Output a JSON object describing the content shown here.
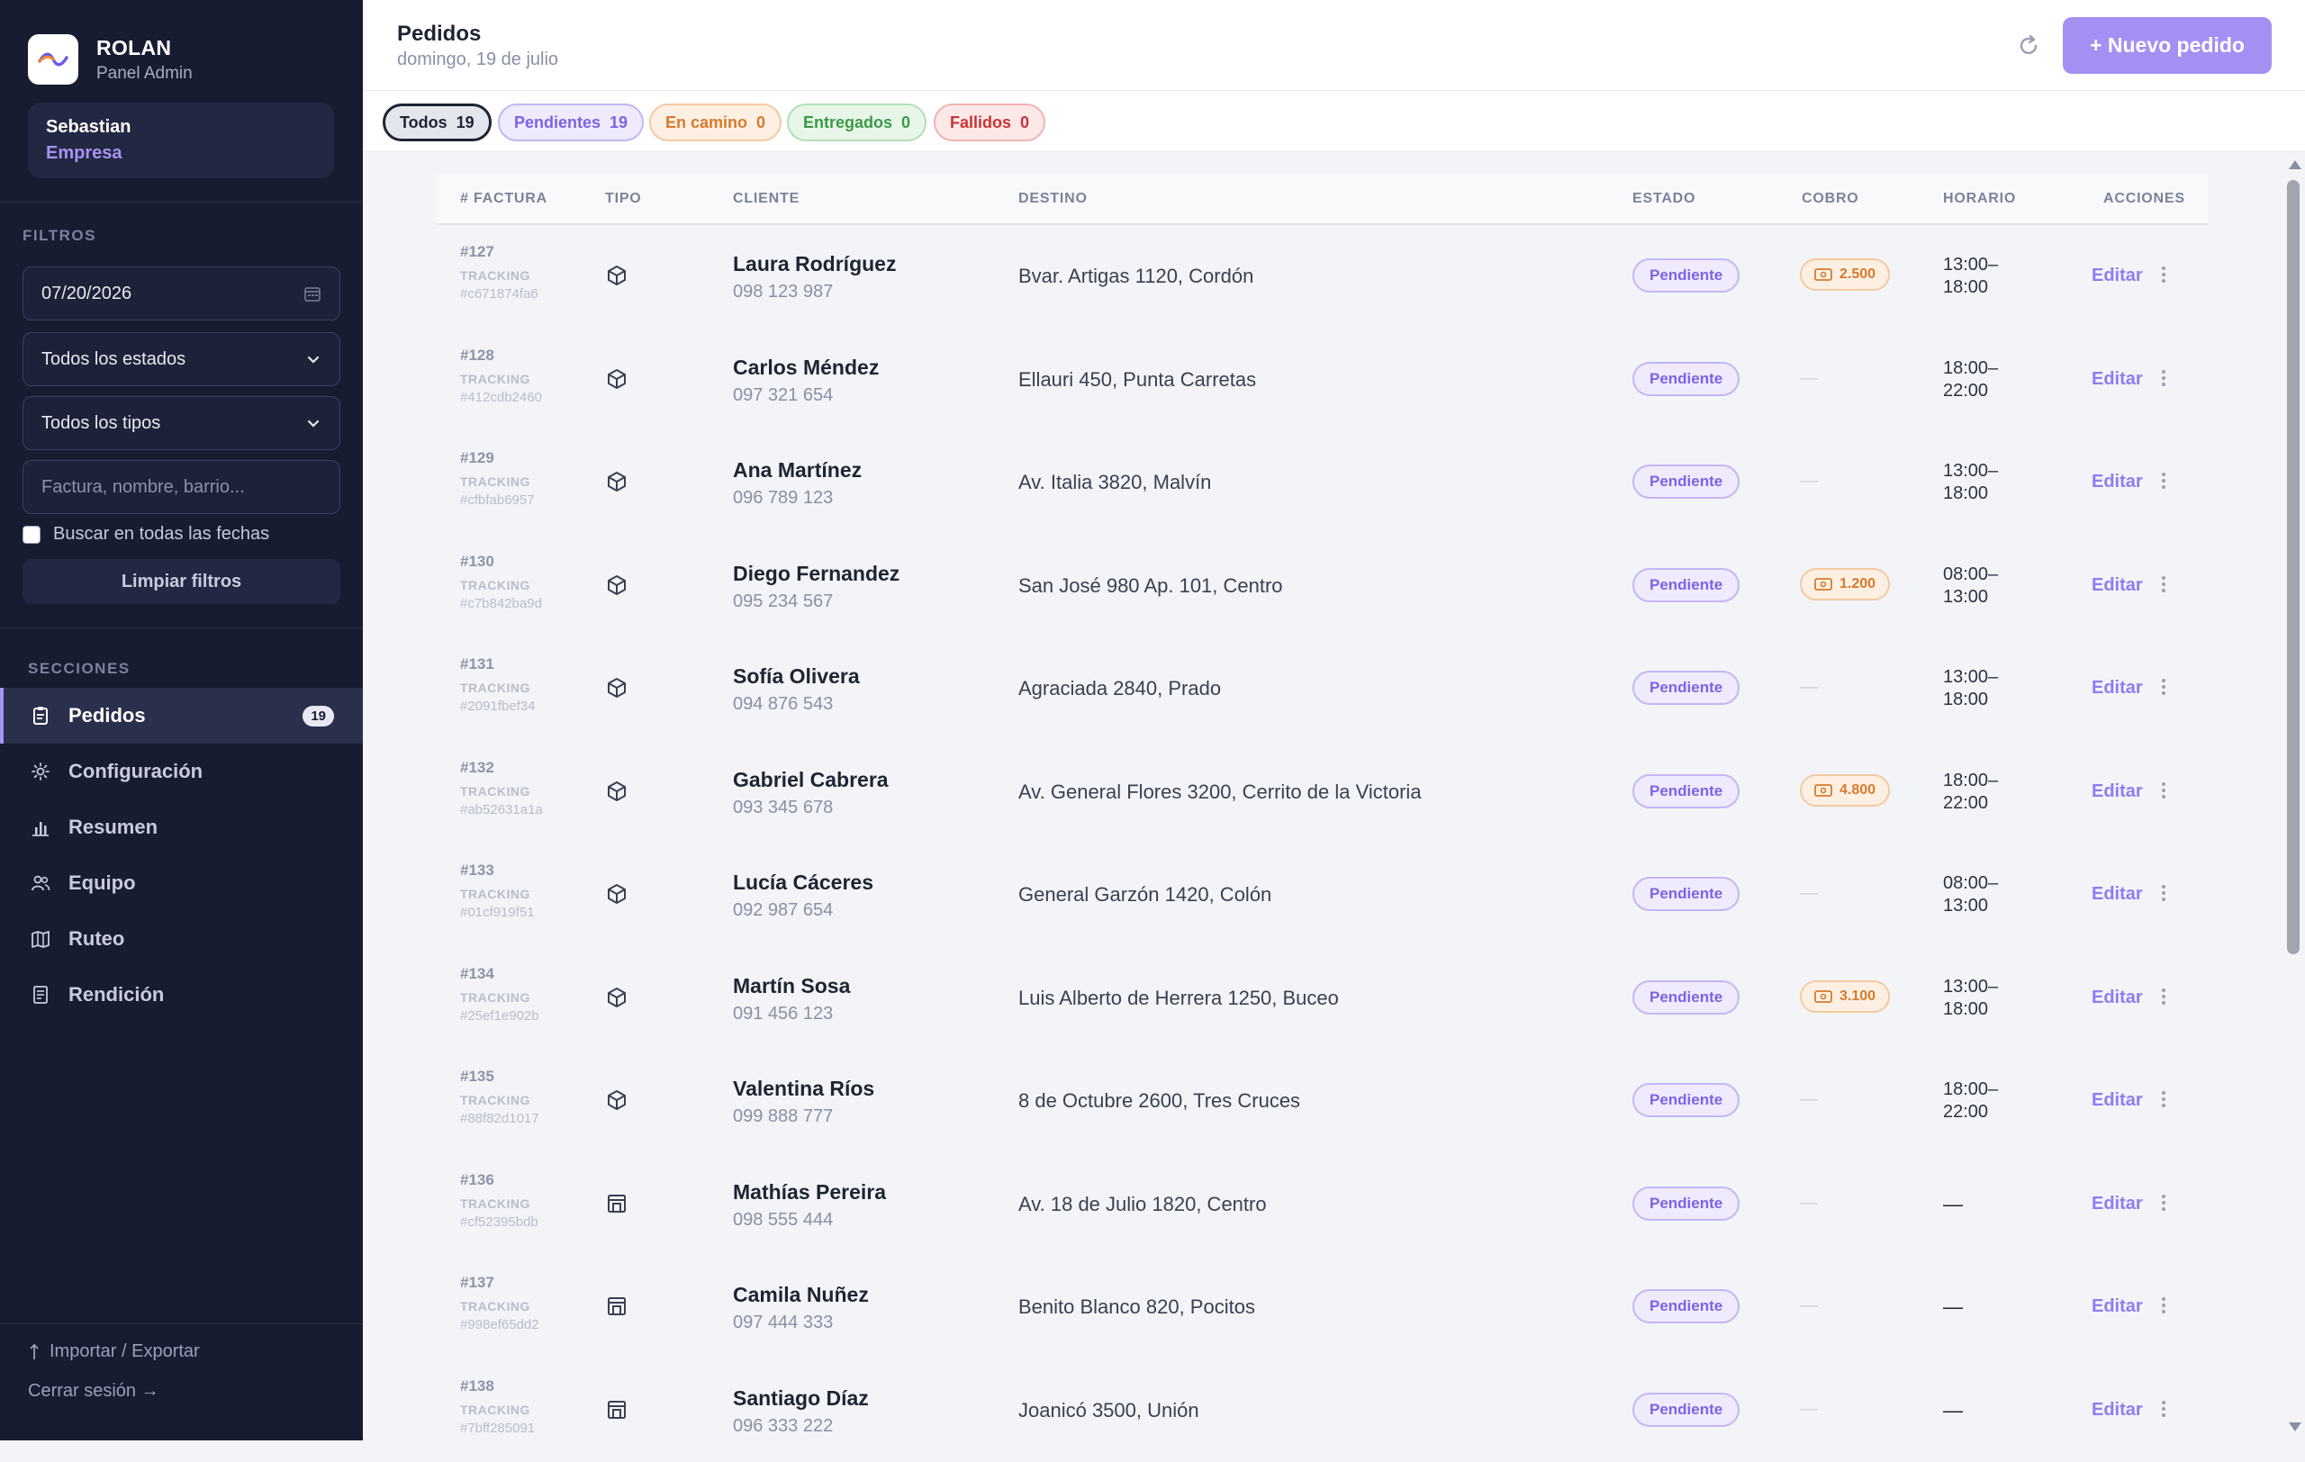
{
  "brand": {
    "name": "ROLAN",
    "subtitle": "Panel Admin"
  },
  "user": {
    "name": "Sebastian",
    "role": "Empresa"
  },
  "filters": {
    "section_label": "FILTROS",
    "date_value": "07/20/2026",
    "status_select": "Todos los estados",
    "type_select": "Todos los tipos",
    "search_placeholder": "Factura, nombre, barrio...",
    "search_all_dates": "Buscar en todas las fechas",
    "clear_label": "Limpiar filtros"
  },
  "sections": {
    "label": "SECCIONES",
    "items": [
      {
        "label": "Pedidos",
        "icon": "clipboard-icon",
        "badge": "19",
        "active": true
      },
      {
        "label": "Configuración",
        "icon": "gear-icon"
      },
      {
        "label": "Resumen",
        "icon": "bar-chart-icon"
      },
      {
        "label": "Equipo",
        "icon": "users-icon"
      },
      {
        "label": "Ruteo",
        "icon": "map-icon"
      },
      {
        "label": "Rendición",
        "icon": "receipt-icon"
      }
    ]
  },
  "footer": {
    "import_export": "Importar / Exportar",
    "logout": "Cerrar sesión →"
  },
  "header": {
    "title": "Pedidos",
    "date": "domingo, 19 de julio",
    "new_button": "+ Nuevo pedido"
  },
  "tabs": [
    {
      "label": "Todos",
      "count": "19"
    },
    {
      "label": "Pendientes",
      "count": "19"
    },
    {
      "label": "En camino",
      "count": "0"
    },
    {
      "label": "Entregados",
      "count": "0"
    },
    {
      "label": "Fallidos",
      "count": "0"
    }
  ],
  "table": {
    "columns": [
      "# FACTURA",
      "TIPO",
      "CLIENTE",
      "DESTINO",
      "ESTADO",
      "COBRO",
      "HORARIO",
      "ACCIONES"
    ],
    "tracking_label": "TRACKING",
    "edit_label": "Editar",
    "empty_dash": "—",
    "rows": [
      {
        "invoice": "#127",
        "tracking": "#c671874fa6",
        "type": "box",
        "client": "Laura Rodríguez",
        "phone": "098 123 987",
        "destination": "Bvar. Artigas 1120, Cordón",
        "status": "Pendiente",
        "cobro": "2.500",
        "hour_start": "13:00–",
        "hour_end": "18:00"
      },
      {
        "invoice": "#128",
        "tracking": "#412cdb2460",
        "type": "box",
        "client": "Carlos Méndez",
        "phone": "097 321 654",
        "destination": "Ellauri 450, Punta Carretas",
        "status": "Pendiente",
        "cobro": null,
        "hour_start": "18:00–",
        "hour_end": "22:00"
      },
      {
        "invoice": "#129",
        "tracking": "#cfbfab6957",
        "type": "box",
        "client": "Ana Martínez",
        "phone": "096 789 123",
        "destination": "Av. Italia 3820, Malvín",
        "status": "Pendiente",
        "cobro": null,
        "hour_start": "13:00–",
        "hour_end": "18:00"
      },
      {
        "invoice": "#130",
        "tracking": "#c7b842ba9d",
        "type": "box",
        "client": "Diego Fernandez",
        "phone": "095 234 567",
        "destination": "San José 980 Ap. 101, Centro",
        "status": "Pendiente",
        "cobro": "1.200",
        "hour_start": "08:00–",
        "hour_end": "13:00"
      },
      {
        "invoice": "#131",
        "tracking": "#2091fbef34",
        "type": "box",
        "client": "Sofía Olivera",
        "phone": "094 876 543",
        "destination": "Agraciada 2840, Prado",
        "status": "Pendiente",
        "cobro": null,
        "hour_start": "13:00–",
        "hour_end": "18:00"
      },
      {
        "invoice": "#132",
        "tracking": "#ab52631a1a",
        "type": "box",
        "client": "Gabriel Cabrera",
        "phone": "093 345 678",
        "destination": "Av. General Flores 3200, Cerrito de la Victoria",
        "status": "Pendiente",
        "cobro": "4.800",
        "hour_start": "18:00–",
        "hour_end": "22:00"
      },
      {
        "invoice": "#133",
        "tracking": "#01cf919f51",
        "type": "box",
        "client": "Lucía Cáceres",
        "phone": "092 987 654",
        "destination": "General Garzón 1420, Colón",
        "status": "Pendiente",
        "cobro": null,
        "hour_start": "08:00–",
        "hour_end": "13:00"
      },
      {
        "invoice": "#134",
        "tracking": "#25ef1e902b",
        "type": "box",
        "client": "Martín Sosa",
        "phone": "091 456 123",
        "destination": "Luis Alberto de Herrera 1250, Buceo",
        "status": "Pendiente",
        "cobro": "3.100",
        "hour_start": "13:00–",
        "hour_end": "18:00"
      },
      {
        "invoice": "#135",
        "tracking": "#88f82d1017",
        "type": "box",
        "client": "Valentina Ríos",
        "phone": "099 888 777",
        "destination": "8 de Octubre 2600, Tres Cruces",
        "status": "Pendiente",
        "cobro": null,
        "hour_start": "18:00–",
        "hour_end": "22:00"
      },
      {
        "invoice": "#136",
        "tracking": "#cf52395bdb",
        "type": "store",
        "client": "Mathías Pereira",
        "phone": "098 555 444",
        "destination": "Av. 18 de Julio 1820, Centro",
        "status": "Pendiente",
        "cobro": null,
        "hour_start": null,
        "hour_end": null
      },
      {
        "invoice": "#137",
        "tracking": "#998ef65dd2",
        "type": "store",
        "client": "Camila Nuñez",
        "phone": "097 444 333",
        "destination": "Benito Blanco 820, Pocitos",
        "status": "Pendiente",
        "cobro": null,
        "hour_start": null,
        "hour_end": null
      },
      {
        "invoice": "#138",
        "tracking": "#7bff285091",
        "type": "store",
        "client": "Santiago Díaz",
        "phone": "096 333 222",
        "destination": "Joanicó 3500, Unión",
        "status": "Pendiente",
        "cobro": null,
        "hour_start": null,
        "hour_end": null
      }
    ]
  },
  "colors": {
    "sidebar_bg": "#181c31",
    "accent": "#a48ff2",
    "pending": "#7b63e5",
    "cobro": "#d87a2c"
  }
}
